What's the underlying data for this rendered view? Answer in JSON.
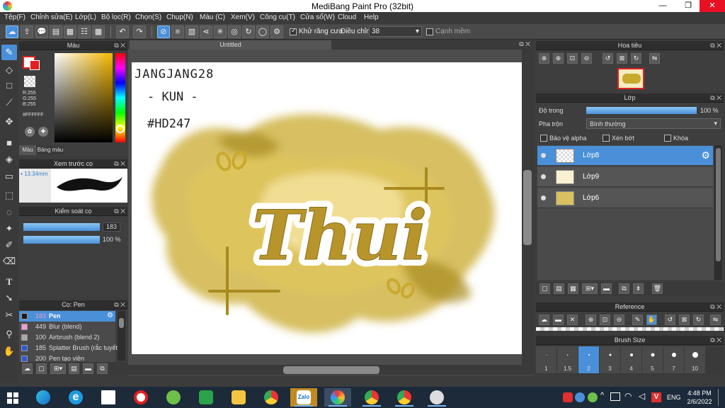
{
  "window": {
    "title": "MediBang Paint Pro (32bit)"
  },
  "menu": [
    "Tệp(F)",
    "Chỉnh sửa(E)",
    "Lớp(L)",
    "Bộ lọc(R)",
    "Chọn(S)",
    "Chụp(N)",
    "Màu (C)",
    "Xem(V)",
    "Công cụ(T)",
    "Cửa sổ(W)",
    "Cloud",
    "Help"
  ],
  "toolbar": {
    "antialias_label": "Khử răng cưa",
    "correction_label": "Điều chỉnh",
    "correction_value": "38",
    "edge_label": "Cạnh mềm"
  },
  "color_panel": {
    "title": "Màu",
    "r": "R:255",
    "g": "G:255",
    "b": "B:255",
    "hex": "#FFFFFF",
    "tab_color": "Màu",
    "tab_palette": "Bảng màu"
  },
  "preview_panel": {
    "title": "Xem trước cọ",
    "size": "13.34mm"
  },
  "brush_control": {
    "title": "Kiểm soát cọ",
    "size_value": "183",
    "opacity_value": "100 %",
    "size_fill": 1.0,
    "opacity_fill": 1.0
  },
  "brush_list": {
    "title": "Cọ: Pen",
    "items": [
      {
        "size": "183",
        "name": "Pen",
        "color": "#1a1a1a",
        "selected": true
      },
      {
        "size": "449",
        "name": "Blur (blend)",
        "color": "#f09bd0"
      },
      {
        "size": "100",
        "name": "Airbrush (blend 2)",
        "color": "#aaaaaa"
      },
      {
        "size": "185",
        "name": "Splatter Brush (rắc tuyết)",
        "color": "#2a5bd7"
      },
      {
        "size": "200",
        "name": "Pen tạo viền",
        "color": "#2a5bd7"
      }
    ]
  },
  "document": {
    "tab_title": "Untitled"
  },
  "artwork": {
    "lines": [
      "JANGJANG28",
      "- KUN -",
      "#HD247"
    ],
    "main_word": "Thui"
  },
  "navigator": {
    "title": "Hoa tiêu"
  },
  "layer_panel": {
    "title": "Lớp",
    "opacity_label": "Độ trong",
    "opacity_value": "100 %",
    "opacity_fill": 1.0,
    "blend_label": "Pha trộn",
    "blend_value": "Bình thường",
    "protect_alpha": "Bảo vệ alpha",
    "clipping": "Xén bớt",
    "lock": "Khóa",
    "layers": [
      {
        "name": "Lớp8",
        "selected": true
      },
      {
        "name": "Lớp9"
      },
      {
        "name": "Lớp6"
      }
    ]
  },
  "reference": {
    "title": "Reference"
  },
  "brush_size": {
    "title": "Brush Size",
    "sizes": [
      "1",
      "1.5",
      "2",
      "3",
      "4",
      "5",
      "7",
      "10"
    ],
    "selected_index": 2
  },
  "taskbar": {
    "lang": "ENG",
    "time": "4:48 PM",
    "date": "2/6/2022"
  },
  "colors": {
    "accent": "#4a90d9",
    "paint_gold": "#c8a83a"
  }
}
